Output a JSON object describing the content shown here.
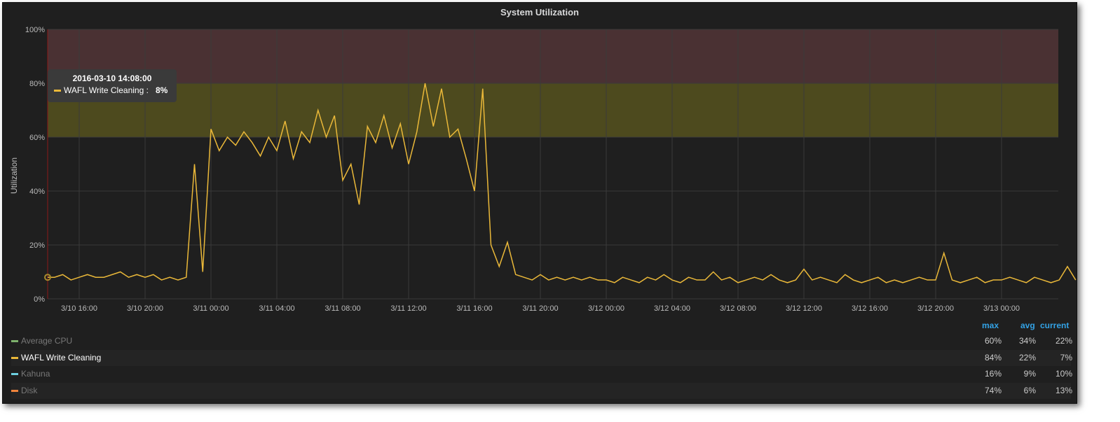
{
  "panel": {
    "title": "System Utilization",
    "y_label": "Utilization"
  },
  "tooltip": {
    "time": "2016-03-10 14:08:00",
    "series": "WAFL Write Cleaning :",
    "value": "8%"
  },
  "legend": {
    "headers": {
      "max": "max",
      "avg": "avg",
      "current": "current"
    },
    "items": [
      {
        "name": "Average CPU",
        "color": "#7eb26d",
        "max": "60%",
        "avg": "34%",
        "current": "22%"
      },
      {
        "name": "WAFL Write Cleaning",
        "color": "#eab839",
        "max": "84%",
        "avg": "22%",
        "current": "7%"
      },
      {
        "name": "Kahuna",
        "color": "#6ed0e0",
        "max": "16%",
        "avg": "9%",
        "current": "10%"
      },
      {
        "name": "Disk",
        "color": "#ef843c",
        "max": "74%",
        "avg": "6%",
        "current": "13%"
      }
    ]
  },
  "chart_data": {
    "type": "line",
    "title": "System Utilization",
    "xlabel": "",
    "ylabel": "Utilization",
    "ylim": [
      0,
      100
    ],
    "y_ticks": [
      "0%",
      "20%",
      "40%",
      "60%",
      "80%",
      "100%"
    ],
    "x_ticks": [
      "3/10 16:00",
      "3/10 20:00",
      "3/11 00:00",
      "3/11 04:00",
      "3/11 08:00",
      "3/11 12:00",
      "3/11 16:00",
      "3/11 20:00",
      "3/12 00:00",
      "3/12 04:00",
      "3/12 08:00",
      "3/12 12:00",
      "3/12 16:00",
      "3/12 20:00",
      "3/13 00:00"
    ],
    "x_start": "2016-03-10 14:00",
    "interval_minutes": 30,
    "x_end_hours": 61.5,
    "thresholds": [
      {
        "from": 60,
        "to": 80,
        "color": "#4d4a1e"
      },
      {
        "from": 80,
        "to": 100,
        "color": "#4a3133"
      }
    ],
    "series": [
      {
        "name": "WAFL Write Cleaning",
        "color": "#eab839",
        "values": [
          8,
          8,
          9,
          7,
          8,
          9,
          8,
          8,
          9,
          10,
          8,
          9,
          8,
          9,
          7,
          8,
          7,
          8,
          50,
          10,
          63,
          55,
          60,
          57,
          62,
          58,
          53,
          60,
          55,
          66,
          52,
          62,
          58,
          70,
          60,
          68,
          44,
          50,
          35,
          64,
          58,
          68,
          56,
          65,
          50,
          62,
          80,
          64,
          78,
          60,
          63,
          52,
          40,
          78,
          20,
          12,
          21,
          9,
          8,
          7,
          9,
          7,
          8,
          7,
          8,
          7,
          8,
          7,
          7,
          6,
          8,
          7,
          6,
          8,
          7,
          9,
          7,
          6,
          8,
          7,
          7,
          10,
          7,
          8,
          6,
          7,
          8,
          7,
          9,
          7,
          6,
          7,
          11,
          7,
          8,
          7,
          6,
          9,
          7,
          6,
          7,
          8,
          6,
          7,
          6,
          7,
          8,
          7,
          7,
          17,
          7,
          6,
          7,
          8,
          6,
          7,
          7,
          8,
          7,
          6,
          8,
          7,
          6,
          7,
          12,
          7
        ]
      }
    ]
  }
}
